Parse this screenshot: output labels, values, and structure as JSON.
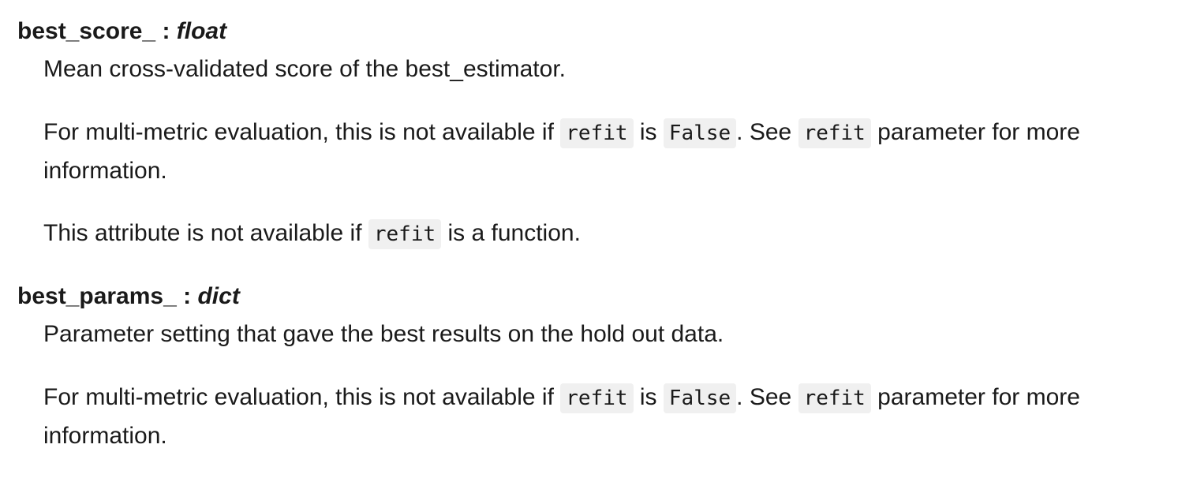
{
  "attributes": [
    {
      "name": "best_score_",
      "separator": " : ",
      "type": "float",
      "summary": "Mean cross-validated score of the best_estimator.",
      "multi_metric": {
        "before": "For multi-metric evaluation, this is not available if ",
        "code1": "refit",
        "mid1": " is ",
        "code2": "False",
        "mid2": ". See ",
        "code3": "refit",
        "after": " parameter for more",
        "line2": "information."
      },
      "function_note": {
        "before": "This attribute is not available if ",
        "code": "refit",
        "after": " is a function."
      }
    },
    {
      "name": "best_params_",
      "separator": " : ",
      "type": "dict",
      "summary": "Parameter setting that gave the best results on the hold out data.",
      "multi_metric": {
        "before": "For multi-metric evaluation, this is not available if ",
        "code1": "refit",
        "mid1": " is ",
        "code2": "False",
        "mid2": ". See ",
        "code3": "refit",
        "after": " parameter for more",
        "line2": "information."
      }
    }
  ]
}
